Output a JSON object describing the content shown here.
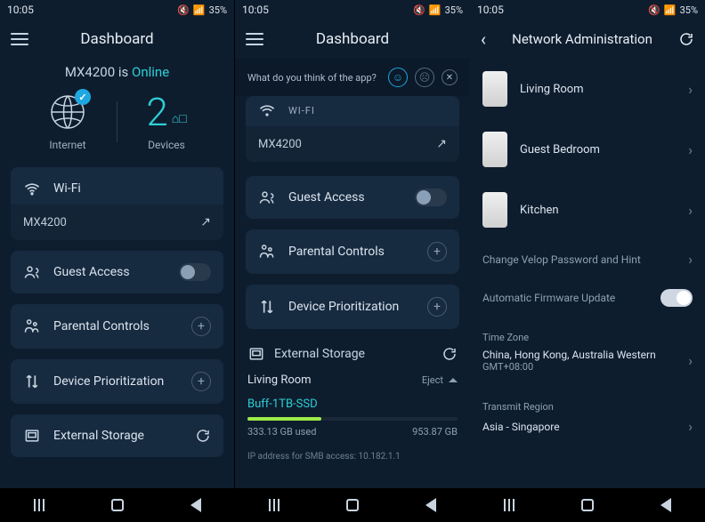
{
  "status_bar": {
    "time": "10:05",
    "battery": "35%"
  },
  "screen1": {
    "title": "Dashboard",
    "model": "MX4200",
    "is_word": "is",
    "status_text": "Online",
    "internet_label": "Internet",
    "devices_count": "2",
    "devices_label": "Devices",
    "wifi_label": "Wi-Fi",
    "wifi_name": "MX4200",
    "guest_label": "Guest Access",
    "parental_label": "Parental Controls",
    "priority_label": "Device Prioritization",
    "storage_label": "External Storage"
  },
  "screen2": {
    "title": "Dashboard",
    "feedback_prompt": "What do you think of the app?",
    "wifi_label": "WI-FI",
    "wifi_name": "MX4200",
    "guest_label": "Guest Access",
    "parental_label": "Parental Controls",
    "priority_label": "Device Prioritization",
    "storage_label": "External Storage",
    "node_name": "Living Room",
    "eject_label": "Eject",
    "drive_name": "Buff-1TB-SSD",
    "used": "333.13 GB used",
    "total": "953.87 GB",
    "ip_label": "IP address for SMB access: 10.182.1.1"
  },
  "screen3": {
    "title": "Network Administration",
    "nodes": [
      {
        "name": "Living Room"
      },
      {
        "name": "Guest Bedroom"
      },
      {
        "name": "Kitchen"
      }
    ],
    "pwd_label": "Change Velop Password and Hint",
    "fw_label": "Automatic Firmware Update",
    "tz_label": "Time Zone",
    "tz_value": "China, Hong Kong, Australia Western",
    "tz_offset": "GMT+08:00",
    "region_label": "Transmit Region",
    "region_value": "Asia - Singapore"
  }
}
